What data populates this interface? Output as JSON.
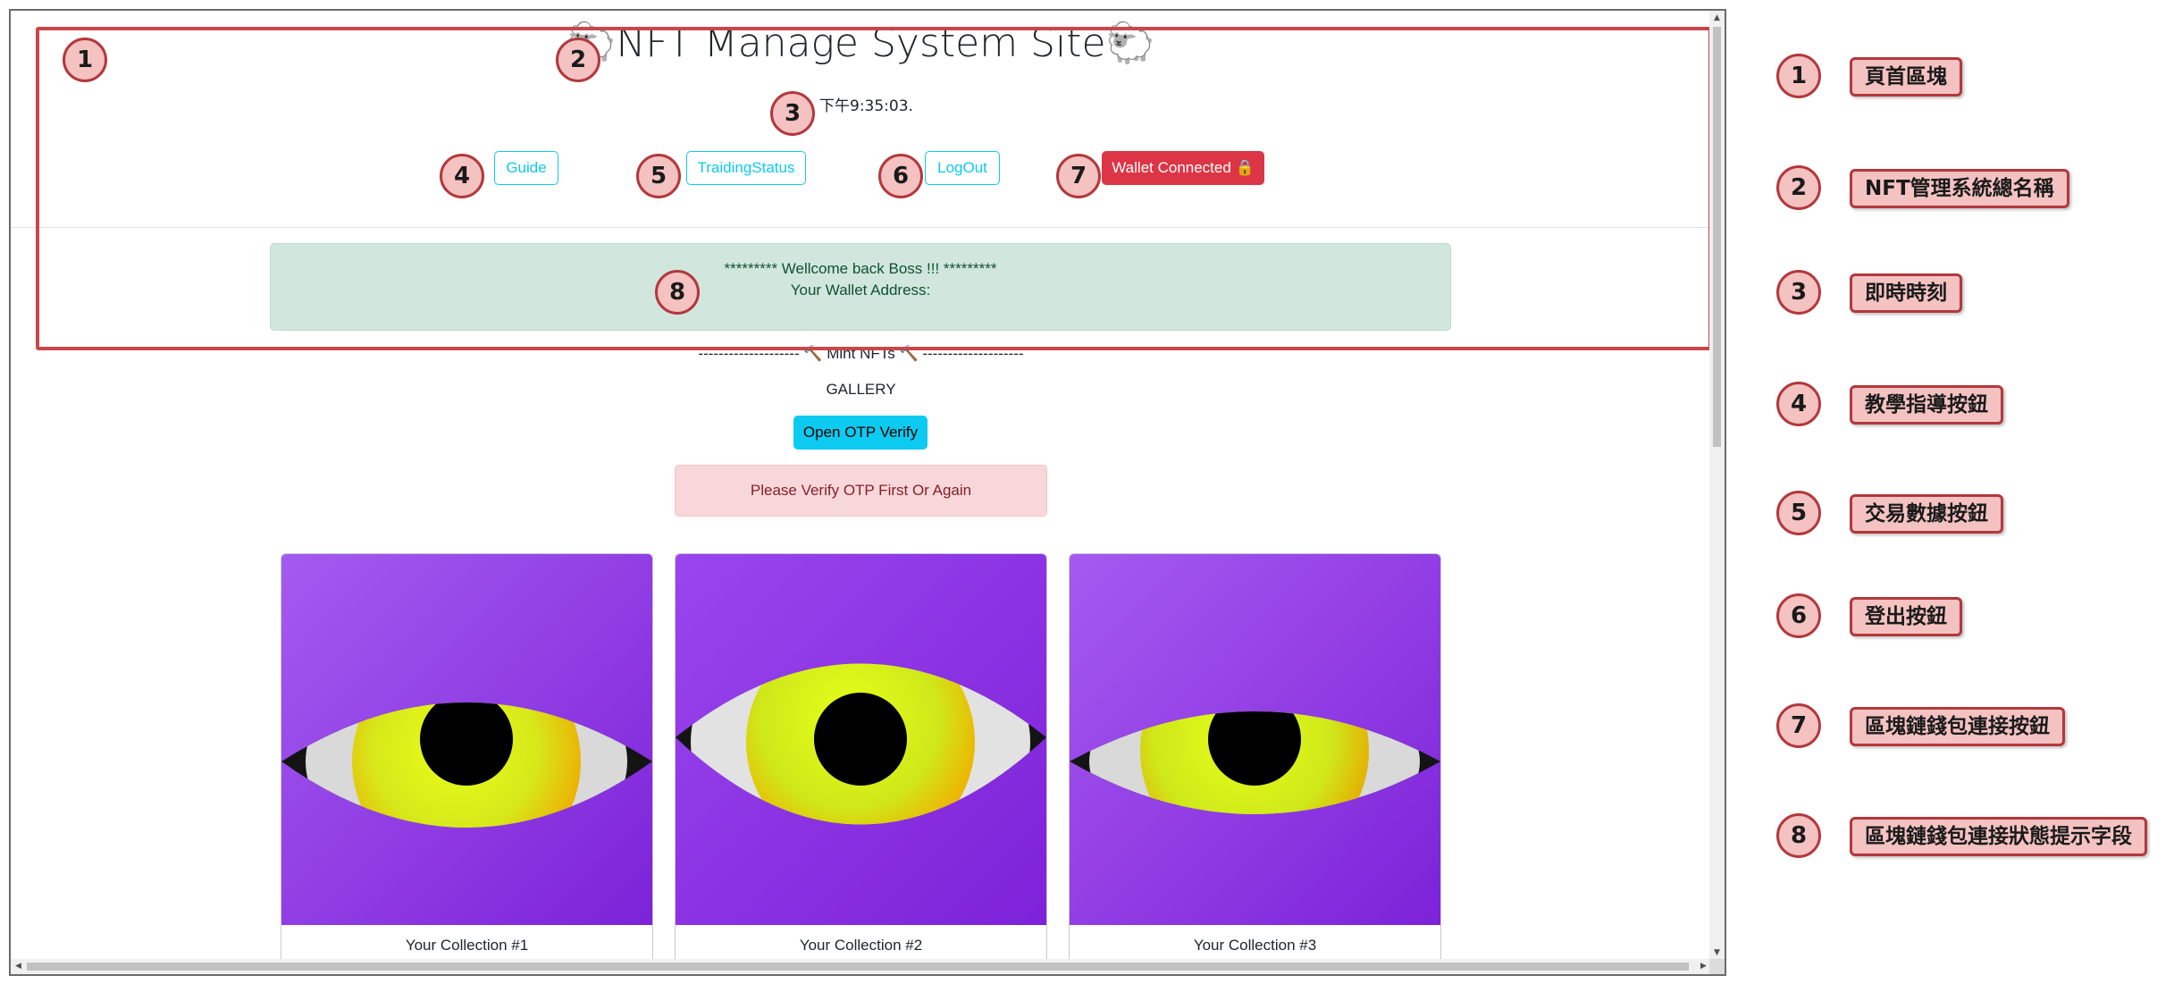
{
  "header": {
    "title": "🐑NFT Manage System Site🐑",
    "clock": "下午9:35:03.",
    "buttons": {
      "guide": "Guide",
      "trading_status": "TraidingStatus",
      "logout": "LogOut",
      "wallet": "Wallet Connected 🔒"
    }
  },
  "welcome": {
    "line1": "********* Wellcome back Boss !!! *********",
    "line2": "Your Wallet Address:"
  },
  "mint": {
    "heading": "-------------------- 🔨 Mint NFTs 🔨 --------------------",
    "gallery": "GALLERY",
    "otp_button": "Open OTP Verify",
    "otp_alert": "Please Verify OTP First Or Again"
  },
  "cards": [
    {
      "caption": "Your Collection #1"
    },
    {
      "caption": "Your Collection #2"
    },
    {
      "caption": "Your Collection #3"
    }
  ],
  "annotations": [
    {
      "num": "1",
      "label": "頁首區塊"
    },
    {
      "num": "2",
      "label": "NFT管理系統總名稱"
    },
    {
      "num": "3",
      "label": "即時時刻"
    },
    {
      "num": "4",
      "label": "教學指導按鈕"
    },
    {
      "num": "5",
      "label": "交易數據按鈕"
    },
    {
      "num": "6",
      "label": "登出按鈕"
    },
    {
      "num": "7",
      "label": "區塊鏈錢包連接按鈕"
    },
    {
      "num": "8",
      "label": "區塊鏈錢包連接狀態提示字段"
    }
  ],
  "colors": {
    "accent_info": "#0dcaf0",
    "danger": "#dc3545",
    "success_bg": "#d1e7dd",
    "annotation_red": "#b3383c",
    "annotation_fill": "#f5c2c2",
    "nft_purple": "#8a2be2"
  }
}
